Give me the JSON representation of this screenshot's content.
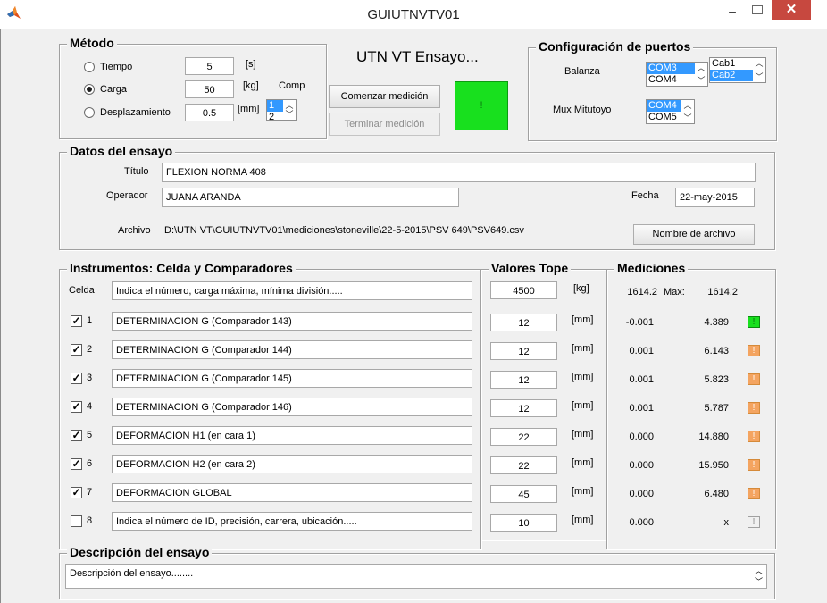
{
  "window": {
    "title": "GUIUTNVTV01",
    "minimize": "–",
    "close": "✕"
  },
  "metodo": {
    "title": "Método",
    "options": [
      {
        "label": "Tiempo",
        "value": "5",
        "unit": "[s]",
        "selected": false
      },
      {
        "label": "Carga",
        "value": "50",
        "unit": "[kg]",
        "selected": true
      },
      {
        "label": "Desplazamiento",
        "value": "0.5",
        "unit": "[mm]",
        "selected": false
      }
    ],
    "comp_label": "Comp",
    "comp_list": [
      "1",
      "2"
    ]
  },
  "header": {
    "heading": "UTN VT Ensayo...",
    "start_button": "Comenzar medición",
    "stop_button": "Terminar medición",
    "status_indicator": "!"
  },
  "puertos": {
    "title": "Configuración de puertos",
    "balanza_label": "Balanza",
    "balanza_ports": [
      "COM3",
      "COM4"
    ],
    "cab_list": [
      "Cab1",
      "Cab2"
    ],
    "mux_label": "Mux Mitutoyo",
    "mux_ports": [
      "COM4",
      "COM5"
    ]
  },
  "datos": {
    "title": "Datos del ensayo",
    "titulo_label": "Título",
    "titulo_value": "FLEXION NORMA 408",
    "operador_label": "Operador",
    "operador_value": "JUANA ARANDA",
    "fecha_label": "Fecha",
    "fecha_value": "22-may-2015",
    "archivo_label": "Archivo",
    "archivo_value": "D:\\UTN VT\\GUIUTNVTV01\\mediciones\\stoneville\\22-5-2015\\PSV 649\\PSV649.csv",
    "archivo_button": "Nombre de archivo"
  },
  "instrumentos": {
    "title": "Instrumentos: Celda y Comparadores",
    "celda_label": "Celda",
    "celda_desc": "Indica el número, carga máxima, mínima división.....",
    "rows": [
      {
        "num": "1",
        "checked": true,
        "desc": "DETERMINACION G (Comparador 143)"
      },
      {
        "num": "2",
        "checked": true,
        "desc": "DETERMINACION G (Comparador 144)"
      },
      {
        "num": "3",
        "checked": true,
        "desc": "DETERMINACION G (Comparador 145)"
      },
      {
        "num": "4",
        "checked": true,
        "desc": "DETERMINACION G (Comparador 146)"
      },
      {
        "num": "5",
        "checked": true,
        "desc": "DEFORMACION H1 (en cara 1)"
      },
      {
        "num": "6",
        "checked": true,
        "desc": "DEFORMACION H2 (en cara 2)"
      },
      {
        "num": "7",
        "checked": true,
        "desc": "DEFORMACION GLOBAL"
      },
      {
        "num": "8",
        "checked": false,
        "desc": "Indica el número de ID, precisión, carrera, ubicación....."
      }
    ]
  },
  "tope": {
    "title": "Valores Tope",
    "celda_value": "4500",
    "celda_unit": "[kg]",
    "rows": [
      {
        "value": "12",
        "unit": "[mm]"
      },
      {
        "value": "12",
        "unit": "[mm]"
      },
      {
        "value": "12",
        "unit": "[mm]"
      },
      {
        "value": "12",
        "unit": "[mm]"
      },
      {
        "value": "22",
        "unit": "[mm]"
      },
      {
        "value": "22",
        "unit": "[mm]"
      },
      {
        "value": "45",
        "unit": "[mm]"
      },
      {
        "value": "10",
        "unit": "[mm]"
      }
    ]
  },
  "mediciones": {
    "title": "Mediciones",
    "celda_current": "1614.2",
    "max_label": "Max:",
    "celda_max": "1614.2",
    "rows": [
      {
        "current": "-0.001",
        "max": "4.389",
        "indicator": "!",
        "state": "green"
      },
      {
        "current": "0.001",
        "max": "6.143",
        "indicator": "!",
        "state": "orange"
      },
      {
        "current": "0.001",
        "max": "5.823",
        "indicator": "!",
        "state": "orange"
      },
      {
        "current": "0.001",
        "max": "5.787",
        "indicator": "!",
        "state": "orange"
      },
      {
        "current": "0.000",
        "max": "14.880",
        "indicator": "!",
        "state": "orange"
      },
      {
        "current": "0.000",
        "max": "15.950",
        "indicator": "!",
        "state": "orange"
      },
      {
        "current": "0.000",
        "max": "6.480",
        "indicator": "!",
        "state": "orange"
      },
      {
        "current": "0.000",
        "max": "x",
        "indicator": "!",
        "state": "gray"
      }
    ]
  },
  "descripcion": {
    "title": "Descripción del ensayo",
    "value": "Descripción del ensayo........"
  },
  "colors": {
    "green_indicator": "#18e01e",
    "orange_indicator": "#f4a460",
    "selection": "#3399ff",
    "close_button": "#c7483f"
  }
}
